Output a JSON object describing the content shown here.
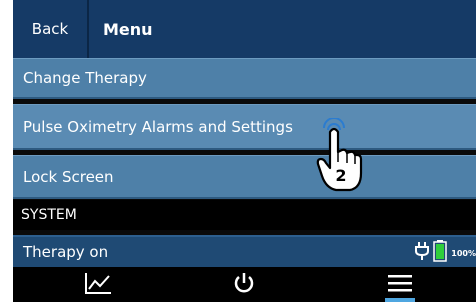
{
  "header": {
    "back_label": "Back",
    "title": "Menu"
  },
  "menu": {
    "items": [
      {
        "label": "Change Therapy"
      },
      {
        "label": "Pulse Oximetry Alarms and Settings"
      },
      {
        "label": "Lock Screen"
      }
    ]
  },
  "system_section": {
    "label": "SYSTEM"
  },
  "status": {
    "text": "Therapy on",
    "battery_percent": "100%",
    "battery_color": "#2fcf3c"
  },
  "bottom_nav": {
    "items": [
      {
        "icon": "trend-chart-icon"
      },
      {
        "icon": "power-icon"
      },
      {
        "icon": "menu-icon"
      }
    ]
  },
  "annotation": {
    "step_number": "2",
    "icon": "pointing-hand-icon"
  },
  "colors": {
    "header_bg": "#153a66",
    "menu_item_bg": "#4e80a8",
    "status_bar_bg": "#1f4a74",
    "nav_accent": "#4fa6e0"
  }
}
